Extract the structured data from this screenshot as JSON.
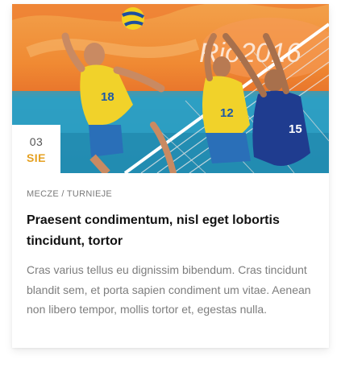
{
  "post": {
    "image_alt": "Volleyball players at the net",
    "date": {
      "day": "03",
      "month": "SIE"
    },
    "category": "MECZE / TURNIEJE",
    "title": "Praesent condimentum, nisl eget lobortis tincidunt, tortor",
    "excerpt": "Cras varius tellus eu dignissim bibendum. Cras tincidunt blandit sem, et porta sapien condiment um vitae. Aenean non libero tempor, mollis tortor et, egestas nulla."
  },
  "image_text": {
    "jersey_left": "18",
    "jersey_middle": "12",
    "jersey_right": "15",
    "backdrop": "Rio2016"
  },
  "colors": {
    "accent": "#e5a021",
    "title": "#111111",
    "excerpt": "#7d7d7d"
  }
}
